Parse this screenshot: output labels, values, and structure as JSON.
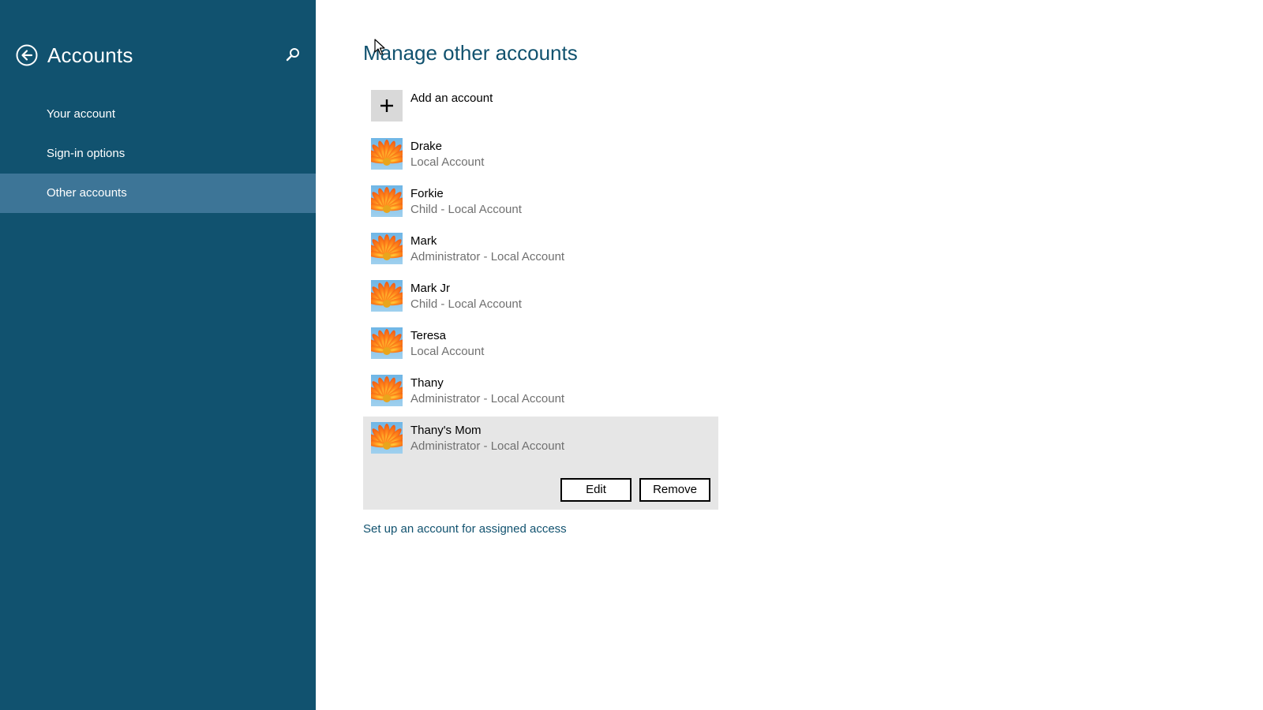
{
  "sidebar": {
    "title": "Accounts",
    "back_icon": "back-arrow-icon",
    "search_icon": "search-icon",
    "items": [
      {
        "label": "Your account",
        "selected": false
      },
      {
        "label": "Sign-in options",
        "selected": false
      },
      {
        "label": "Other accounts",
        "selected": true
      }
    ]
  },
  "main": {
    "title": "Manage other accounts",
    "add_account_label": "Add an account",
    "add_icon": "plus-icon",
    "accounts": [
      {
        "name": "Drake",
        "type": "Local Account"
      },
      {
        "name": "Forkie",
        "type": "Child - Local Account"
      },
      {
        "name": "Mark",
        "type": "Administrator - Local Account"
      },
      {
        "name": "Mark Jr",
        "type": "Child - Local Account"
      },
      {
        "name": "Teresa",
        "type": "Local Account"
      },
      {
        "name": "Thany",
        "type": "Administrator - Local Account"
      }
    ],
    "selected_account": {
      "name": "Thany's Mom",
      "type": "Administrator - Local Account"
    },
    "edit_label": "Edit",
    "remove_label": "Remove",
    "assigned_access_link": "Set up an account for assigned access"
  },
  "colors": {
    "sidebar_bg": "#11526f",
    "sidebar_selected": "#3d7597",
    "accent_text": "#11526f",
    "selected_row_bg": "#e6e6e6",
    "secondary_text": "#707070"
  }
}
